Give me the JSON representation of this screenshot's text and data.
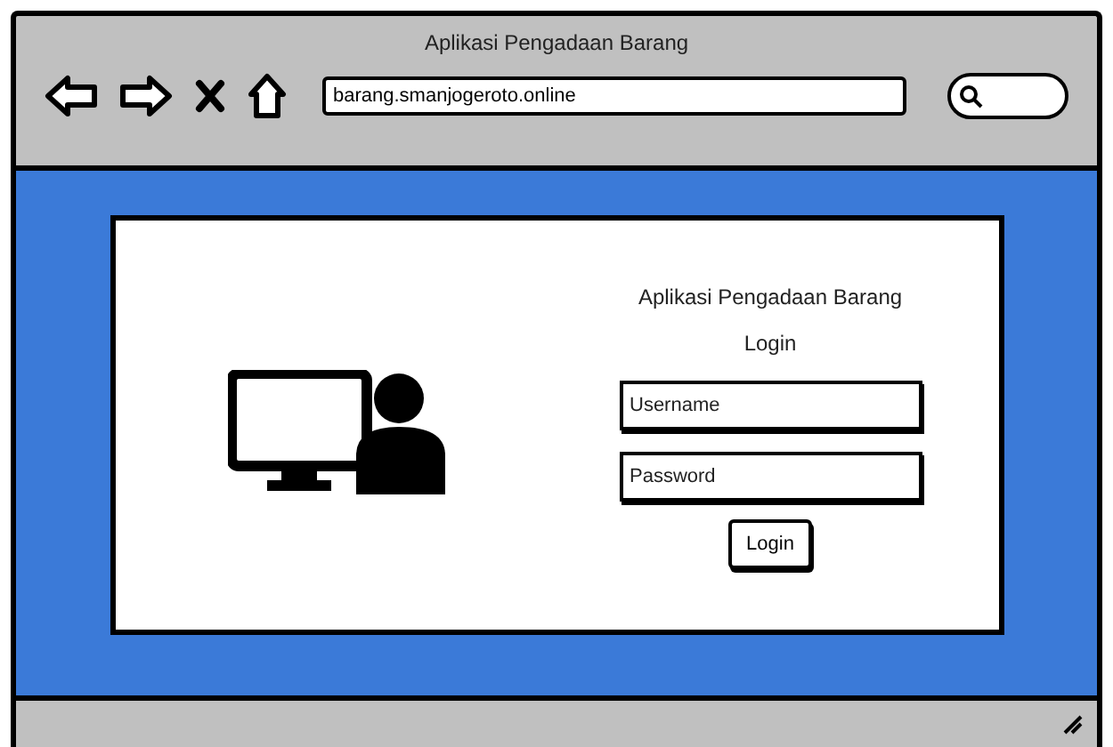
{
  "window": {
    "title": "Aplikasi Pengadaan Barang"
  },
  "address_bar": {
    "value": "barang.smanjogeroto.online"
  },
  "login": {
    "title": "Aplikasi Pengadaan Barang",
    "subtitle": "Login",
    "fields": [
      {
        "placeholder": "Username"
      },
      {
        "placeholder": "Password"
      }
    ],
    "button": "Login"
  }
}
